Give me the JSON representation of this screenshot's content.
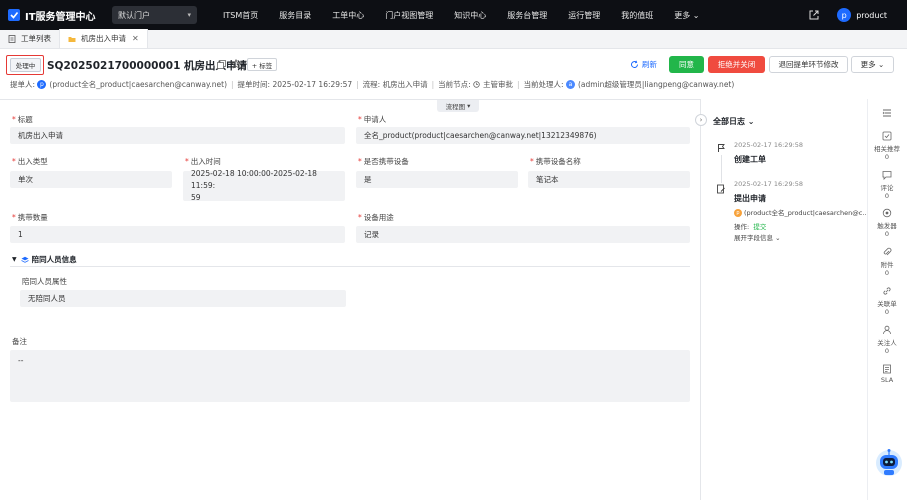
{
  "nav": {
    "app_title": "IT服务管理中心",
    "portal_select": "默认门户",
    "items": [
      "ITSM首页",
      "服务目录",
      "工单中心",
      "门户视图管理",
      "知识中心",
      "服务台管理",
      "运行管理",
      "我的值班",
      "更多"
    ],
    "user_initial": "p",
    "user_name": "product"
  },
  "tabs": [
    {
      "label": "工单列表"
    },
    {
      "label": "机房出入申请"
    }
  ],
  "header": {
    "status_badge": "处理中",
    "ticket_id": "SQ2025021700000001 机房出入申请",
    "tag_button": "+ 标签",
    "refresh": "刷新",
    "agree": "同意",
    "reject_close": "拒绝并关闭",
    "return_modify": "退回提单环节修改",
    "more": "更多"
  },
  "meta": {
    "submitter_label": "提单人:",
    "submitter_initial": "p",
    "submitter_value": "(product全名_product|caesarchen@canway.net)",
    "time_label": "提单时间: 2025-02-17 16:29:57",
    "flow_label": "流程: 机房出入申请",
    "node_label": "当前节点:",
    "node_value": "主管审批",
    "handler_label": "当前处理人:",
    "handler_initial": "a",
    "handler_value": "(admin超级管理员|liangpeng@canway.net)"
  },
  "flowchart_button": "流程图",
  "form": {
    "title_label": "标题",
    "title_value": "机房出入申请",
    "applicant_label": "申请人",
    "applicant_value": "全名_product(product|caesarchen@canway.net|13212349876)",
    "type_label": "出入类型",
    "type_value": "单次",
    "time_label": "出入时间",
    "time_value_line1": "2025-02-18 10:00:00-2025-02-18 11:59:",
    "time_value_line2": "59",
    "carry_label": "是否携带设备",
    "carry_value": "是",
    "device_name_label": "携带设备名称",
    "device_name_value": "笔记本",
    "count_label": "携带数量",
    "count_value": "1",
    "usage_label": "设备用途",
    "usage_value": "记录",
    "section_title": "陪同人员信息",
    "companion_label": "陪同人员属性",
    "companion_value": "无陪同人员",
    "remark_label": "备注",
    "remark_value": "--"
  },
  "log": {
    "title": "全部日志",
    "entries": [
      {
        "time": "2025-02-17 16:29:58",
        "title": "创建工单"
      },
      {
        "time": "2025-02-17 16:29:58",
        "title": "提出申请",
        "user_initial": "p",
        "user": "(product全名_product|caesarchen@c...",
        "op_label": "操作:",
        "op_value": "提交",
        "expand": "展开字段信息"
      }
    ]
  },
  "side_tools": [
    {
      "label": "相关推荐",
      "count": "0",
      "icon": "recommend-icon"
    },
    {
      "label": "评论",
      "count": "0",
      "icon": "comment-icon"
    },
    {
      "label": "触发器",
      "count": "0",
      "icon": "trigger-icon"
    },
    {
      "label": "附件",
      "count": "0",
      "icon": "attachment-icon"
    },
    {
      "label": "关联单",
      "count": "0",
      "icon": "link-icon"
    },
    {
      "label": "关注人",
      "count": "0",
      "icon": "follower-icon"
    },
    {
      "label": "SLA",
      "count": "",
      "icon": "sla-icon"
    }
  ],
  "colors": {
    "primary": "#1e6bff",
    "agree": "#22b64a",
    "reject": "#f04b3f",
    "highlight": "#e53935"
  }
}
